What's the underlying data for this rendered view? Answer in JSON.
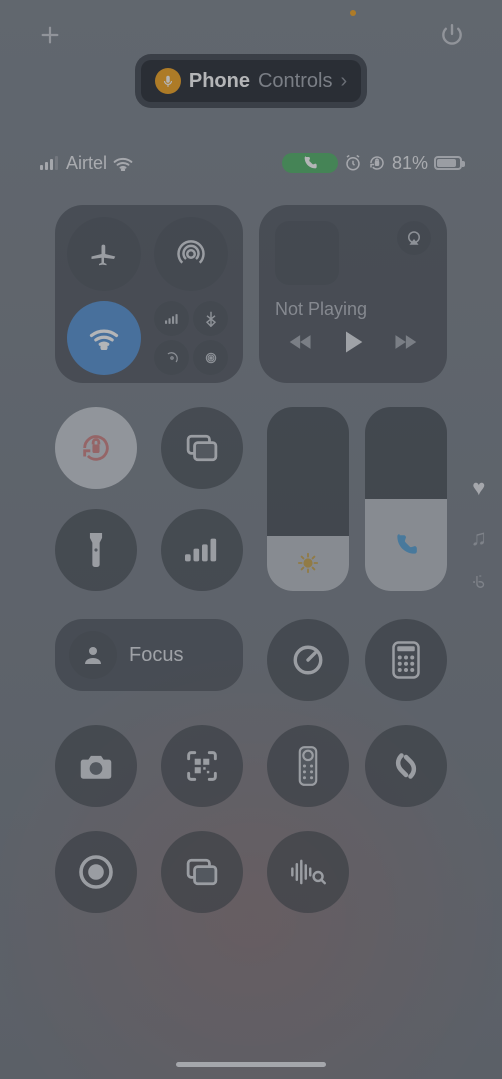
{
  "topbar": {
    "plus": "+",
    "power": "⏻"
  },
  "tag": {
    "primary": "Phone",
    "secondary": "Controls",
    "chevron": "›"
  },
  "status": {
    "carrier": "Airtel",
    "battery_percent": "81%",
    "call_active": true
  },
  "connectivity": {
    "airplane": "airplane-icon",
    "airdrop": "airdrop-icon",
    "wifi_on": true,
    "mini": [
      "cellular",
      "bluetooth",
      "satellite",
      "hotspot"
    ]
  },
  "media": {
    "now_playing": "Not Playing",
    "prev": "⏮",
    "play": "▶",
    "next": "⏭"
  },
  "controls": {
    "orientation_lock": "orientation-lock",
    "screen_mirror": "screen-mirror",
    "flashlight": "flashlight",
    "cellular_ui": "signal-bars",
    "brightness_pct": 30,
    "volume_pct": 50
  },
  "focus": {
    "label": "Focus"
  },
  "shortcuts": {
    "timer": "timer",
    "calculator": "calculator",
    "camera": "camera",
    "qr": "qr-scanner",
    "remote": "apple-tv-remote",
    "shazam": "shazam",
    "screen_record": "screen-record",
    "mirror2": "screen-mirror",
    "sound_recognition": "sound-recognition"
  },
  "side": {
    "heart": "♥",
    "music": "♫",
    "airpods": "ᯤ"
  }
}
